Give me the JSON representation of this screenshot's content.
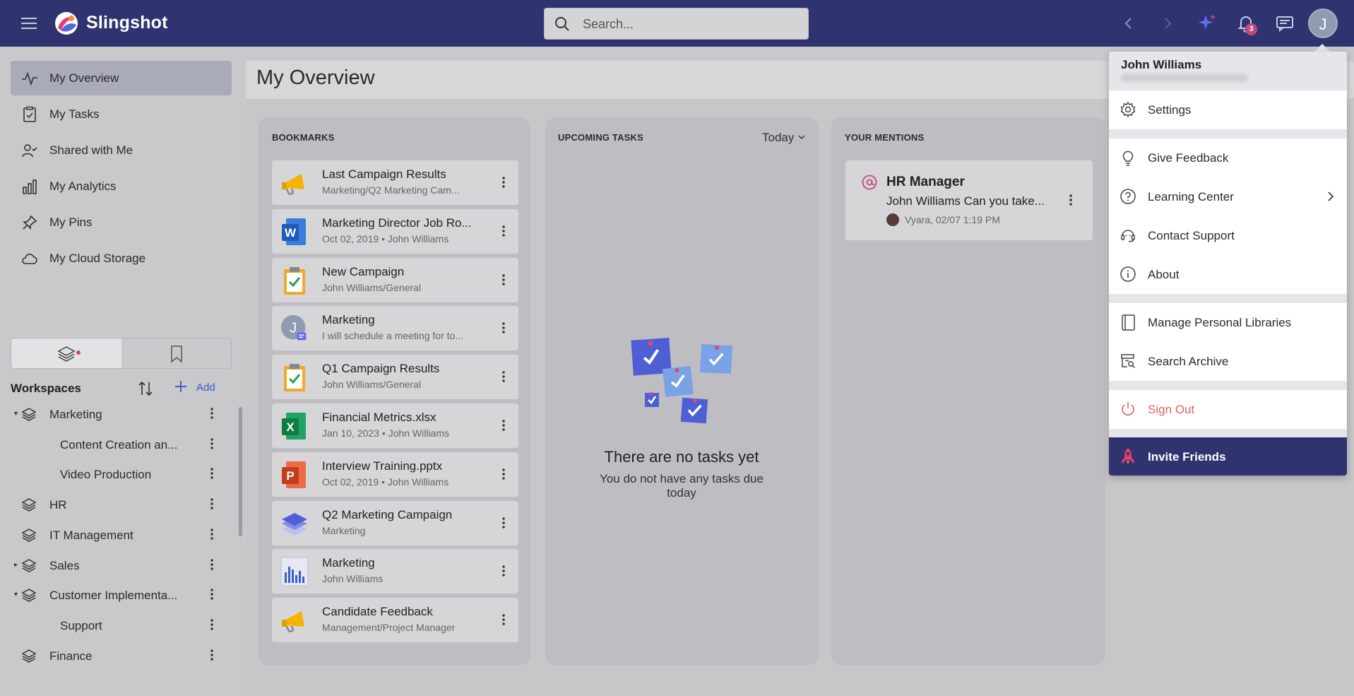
{
  "app": {
    "name": "Slingshot"
  },
  "search": {
    "placeholder": "Search..."
  },
  "notifications": {
    "count": "3"
  },
  "user": {
    "initial": "J",
    "name": "John Williams"
  },
  "sidebar": {
    "items": [
      {
        "label": "My Overview",
        "icon": "activity-icon",
        "active": true
      },
      {
        "label": "My Tasks",
        "icon": "clipboard-check-icon"
      },
      {
        "label": "Shared with Me",
        "icon": "user-check-icon"
      },
      {
        "label": "My Analytics",
        "icon": "bar-chart-icon"
      },
      {
        "label": "My Pins",
        "icon": "pin-icon"
      },
      {
        "label": "My Cloud Storage",
        "icon": "cloud-icon"
      }
    ]
  },
  "workspaces": {
    "title": "Workspaces",
    "add_label": "Add",
    "items": [
      {
        "label": "Marketing",
        "expanded": true
      },
      {
        "label": "Content Creation an...",
        "child": true
      },
      {
        "label": "Video Production",
        "child": true
      },
      {
        "label": "HR"
      },
      {
        "label": "IT Management"
      },
      {
        "label": "Sales",
        "collapsed": true
      },
      {
        "label": "Customer Implementa...",
        "expanded": true
      },
      {
        "label": "Support",
        "child": true
      },
      {
        "label": "Finance"
      }
    ]
  },
  "main": {
    "title": "My Overview",
    "bookmarks": {
      "title": "BOOKMARKS",
      "items": [
        {
          "title": "Last Campaign Results",
          "subtitle": "Marketing/Q2 Marketing Cam...",
          "icon": "megaphone-icon"
        },
        {
          "title": "Marketing Director Job Ro...",
          "subtitle": "Oct 02, 2019  •  John Williams",
          "icon": "word-doc-icon"
        },
        {
          "title": "New Campaign",
          "subtitle": "John Williams/General",
          "icon": "clipboard-check-icon"
        },
        {
          "title": "Marketing",
          "subtitle": "I will schedule a meeting for to...",
          "icon": "user-avatar-icon"
        },
        {
          "title": "Q1 Campaign Results",
          "subtitle": "John Williams/General",
          "icon": "clipboard-check-icon"
        },
        {
          "title": "Financial Metrics.xlsx",
          "subtitle": "Jan 10, 2023  •  John Williams",
          "icon": "excel-icon"
        },
        {
          "title": "Interview Training.pptx",
          "subtitle": "Oct 02, 2019  •  John Williams",
          "icon": "powerpoint-icon"
        },
        {
          "title": "Q2 Marketing Campaign",
          "subtitle": "Marketing",
          "icon": "layers-icon"
        },
        {
          "title": "Marketing",
          "subtitle": "John Williams",
          "icon": "dashboard-chart-icon"
        },
        {
          "title": "Candidate Feedback",
          "subtitle": "Management/Project Manager",
          "icon": "megaphone-icon"
        }
      ]
    },
    "tasks": {
      "title": "UPCOMING TASKS",
      "filter": "Today",
      "empty_title": "There are no tasks yet",
      "empty_sub": "You do not have any tasks due today"
    },
    "mentions": {
      "title": "YOUR MENTIONS",
      "items": [
        {
          "title": "HR Manager",
          "message": "John Williams Can you take...",
          "meta": "Vyara, 02/07 1:19 PM"
        }
      ]
    }
  },
  "user_menu": {
    "name": "John Williams",
    "items": [
      {
        "label": "Settings",
        "icon": "gear-icon"
      },
      {
        "label": "Give Feedback",
        "icon": "lightbulb-icon"
      },
      {
        "label": "Learning Center",
        "icon": "help-circle-icon"
      },
      {
        "label": "Contact Support",
        "icon": "headset-icon"
      },
      {
        "label": "About",
        "icon": "info-icon"
      },
      {
        "label": "Manage Personal Libraries",
        "icon": "book-icon"
      },
      {
        "label": "Search Archive",
        "icon": "archive-search-icon"
      },
      {
        "label": "Sign Out",
        "icon": "power-icon"
      }
    ],
    "invite_label": "Invite Friends"
  },
  "colors": {
    "topbar": "#2f3470",
    "accent": "#3d4fc9",
    "signout": "#e06060",
    "badge": "#c2477f"
  }
}
